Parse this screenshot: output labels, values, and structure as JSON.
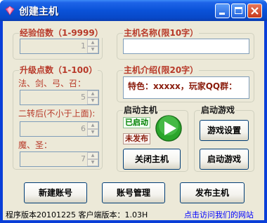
{
  "window": {
    "title": "创建主机"
  },
  "exp_group": {
    "label": "经验倍数（1-9999）",
    "value": "1"
  },
  "points_group": {
    "label": "升级点数（1-100）",
    "fields": [
      {
        "label": "法、剑、弓、召：",
        "value": "5"
      },
      {
        "label": "二转后(不小于上面):",
        "value": "6"
      },
      {
        "label": "魔、圣：",
        "value": "7"
      }
    ]
  },
  "host_name": {
    "label": "主机名称(限10字）",
    "value": ""
  },
  "host_intro": {
    "label": "主机介绍(限20字）",
    "value": "特色：xxxxx，玩家QQ群："
  },
  "start_host": {
    "label": "启动主机",
    "status_started": "已启动",
    "status_unpublished": "未发布",
    "close_button": "关闭主机"
  },
  "start_game": {
    "label": "启动游戏",
    "settings_button": "游戏设置",
    "launch_button": "启动游戏"
  },
  "buttons": {
    "new_account": "新建账号",
    "account_manage": "账号管理",
    "publish_host": "发布主机"
  },
  "footer": {
    "version": "程序版本20101225 客户端版本：1.03H",
    "website_link": "点击访问我们的网站"
  },
  "colors": {
    "accent_red": "#b83a2a",
    "link_blue": "#0000ff",
    "started_green": "#008000",
    "play_green": "#2aa52a"
  }
}
